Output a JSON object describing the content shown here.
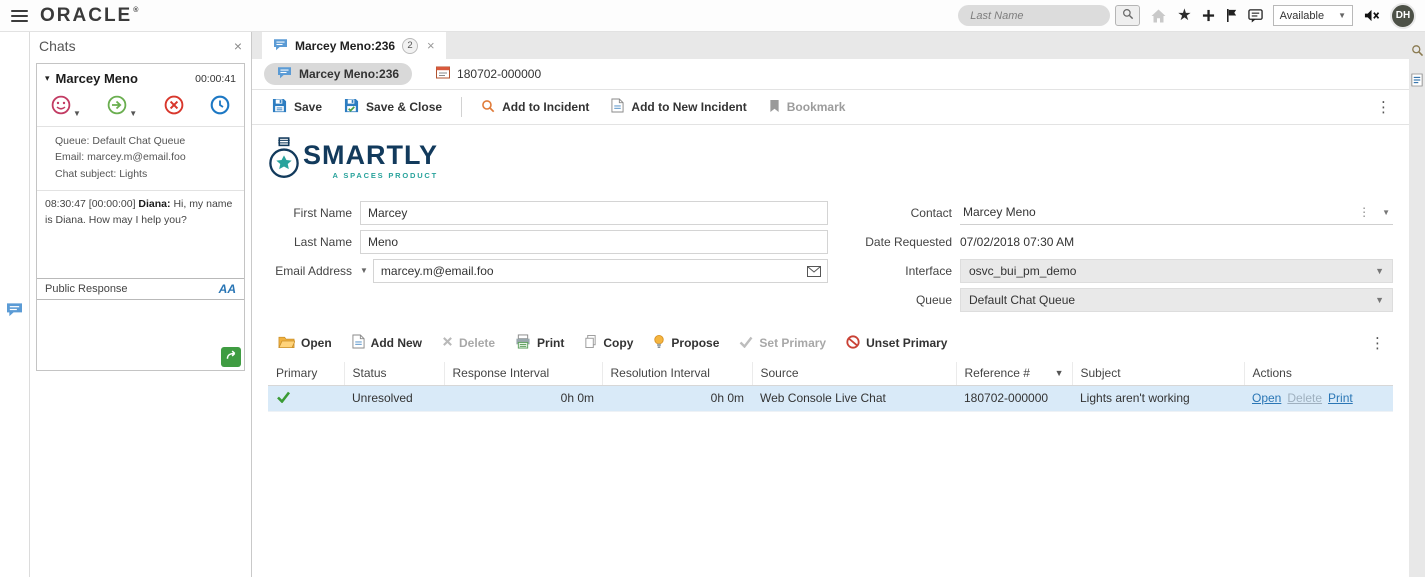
{
  "header": {
    "brand": "ORACLE",
    "search_placeholder": "Last Name",
    "availability": "Available",
    "avatar_initials": "DH"
  },
  "left_panel": {
    "title": "Chats",
    "chat": {
      "name": "Marcey Meno",
      "timer": "00:00:41",
      "queue_line": "Queue: Default Chat Queue",
      "email_line": "Email: marcey.m@email.foo",
      "subject_line": "Chat subject: Lights",
      "message_time": "08:30:47 [00:00:00]",
      "message_sender": "Diana:",
      "message_text": "Hi, my name is Diana. How may I help you?",
      "response_label": "Public Response",
      "font_toggle": "AA"
    }
  },
  "workspace": {
    "tab": {
      "label": "Marcey Meno:236",
      "badge": "2"
    },
    "subtab_contact": "Marcey Meno:236",
    "subtab_incident": "180702-000000",
    "ribbon": {
      "save": "Save",
      "save_close": "Save & Close",
      "add_to_incident": "Add to Incident",
      "add_to_new_incident": "Add to New Incident",
      "bookmark": "Bookmark"
    },
    "logo": {
      "title": "SMARTLY",
      "subtitle": "A SPACES PRODUCT"
    },
    "form": {
      "first_name_label": "First Name",
      "first_name_value": "Marcey",
      "last_name_label": "Last Name",
      "last_name_value": "Meno",
      "email_label": "Email Address",
      "email_value": "marcey.m@email.foo",
      "contact_label": "Contact",
      "contact_value": "Marcey Meno",
      "date_requested_label": "Date Requested",
      "date_requested_value": "07/02/2018 07:30 AM",
      "interface_label": "Interface",
      "interface_value": "osvc_bui_pm_demo",
      "queue_label": "Queue",
      "queue_value": "Default Chat Queue"
    },
    "incident_toolbar": {
      "open": "Open",
      "add_new": "Add New",
      "delete": "Delete",
      "print": "Print",
      "copy": "Copy",
      "propose": "Propose",
      "set_primary": "Set Primary",
      "unset_primary": "Unset Primary"
    },
    "incidents_table": {
      "columns": [
        "Primary",
        "Status",
        "Response Interval",
        "Resolution Interval",
        "Source",
        "Reference #",
        "Subject",
        "Actions"
      ],
      "rows": [
        {
          "status": "Unresolved",
          "response_interval": "0h 0m",
          "resolution_interval": "0h 0m",
          "source": "Web Console Live Chat",
          "reference": "180702-000000",
          "subject": "Lights aren't working",
          "actions": {
            "open": "Open",
            "delete": "Delete",
            "print": "Print"
          }
        }
      ]
    }
  },
  "colors": {
    "accent_blue": "#5b9bd5",
    "selected_row": "#d9eaf8",
    "link": "#2a76b5",
    "logo_navy": "#123a5c",
    "logo_teal": "#29a39c",
    "send_green": "#3f9c42"
  }
}
